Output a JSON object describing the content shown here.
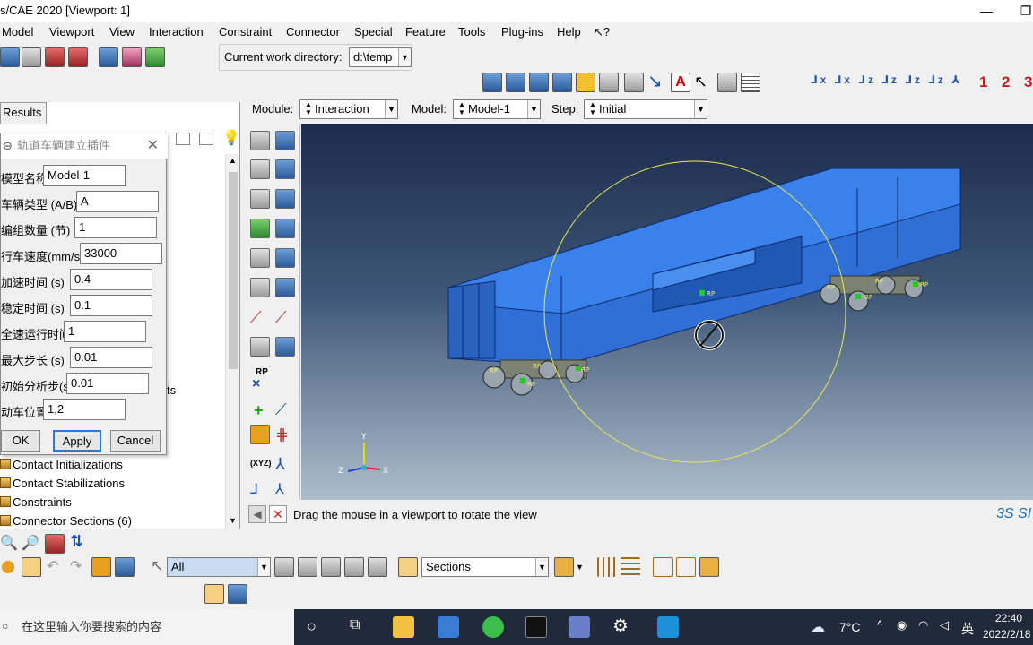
{
  "window": {
    "title": "s/CAE 2020 [Viewport: 1]",
    "minimize": "—",
    "restore": "❐"
  },
  "menu": [
    "Model",
    "Viewport",
    "View",
    "Interaction",
    "Constraint",
    "Connector",
    "Special",
    "Feature",
    "Tools",
    "Plug-ins",
    "Help",
    "↖?"
  ],
  "toolbar": {
    "cwd_label": "Current work directory:",
    "cwd_value": "d:\\temp",
    "view_numbers": [
      "1",
      "2",
      "3"
    ]
  },
  "results_tab": "Results",
  "module_bar": {
    "module_label": "Module:",
    "module_value": "Interaction",
    "model_label": "Model:",
    "model_value": "Model-1",
    "step_label": "Step:",
    "step_value": "Initial"
  },
  "dialog": {
    "title": "轨道车辆建立插件",
    "fields": [
      {
        "label": "模型名称",
        "value": "Model-1"
      },
      {
        "label": "车辆类型 (A/B)",
        "value": "A"
      },
      {
        "label": "编组数量 (节)",
        "value": "1"
      },
      {
        "label": "行车速度(mm/s)",
        "value": "33000"
      },
      {
        "label": "加速时间 (s)",
        "value": "0.4"
      },
      {
        "label": "稳定时间 (s)",
        "value": "0.1"
      },
      {
        "label": "全速运行时间",
        "value": "1"
      },
      {
        "label": "最大步长 (s)",
        "value": "0.01"
      },
      {
        "label": "初始分析步(s)",
        "value": "0.01"
      },
      {
        "label": "动车位置",
        "value": "1,2"
      }
    ],
    "ok": "OK",
    "apply": "Apply",
    "cancel": "Cancel"
  },
  "tree": {
    "partial": "ts",
    "items": [
      "Contact Initializations",
      "Contact Stabilizations",
      "Constraints",
      "Connector Sections (6)"
    ]
  },
  "viewport": {
    "rp_label": "RP",
    "triad": {
      "x": "X",
      "y": "Y",
      "z": "Z"
    }
  },
  "toolbox": {
    "rp_label": "RP",
    "xyz_label": "(XYZ)"
  },
  "prompt": {
    "text": "Drag the mouse in a viewport to rotate the view",
    "brand": "3S SI"
  },
  "selection": {
    "filter_value": "All",
    "sections_value": "Sections"
  },
  "taskbar": {
    "search_placeholder": "在这里输入你要搜索的内容",
    "weather": "7°C",
    "ime": "英",
    "time": "22:40",
    "date": "2022/2/18"
  },
  "colors": {
    "vehicle_blue": "#2f6fd6",
    "viewport_top": "#1c2c4c",
    "viewport_bottom": "#aebdcc",
    "taskbar": "#202a3a"
  }
}
